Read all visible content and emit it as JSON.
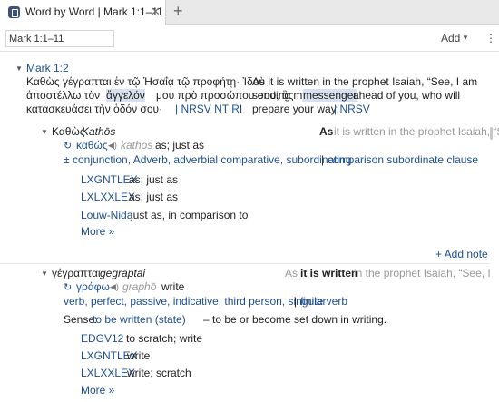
{
  "tab": {
    "title": "Word by Word | Mark 1:1–11",
    "close": "✕",
    "new": "+"
  },
  "toolbar": {
    "reference": "Mark 1:1–11",
    "add_label": "Add",
    "add_caret": "▼",
    "more": "⋮"
  },
  "passage": {
    "ref": "Mark 1:2",
    "greek_lines": [
      "Καθὼς γέγραπται ἐν τῷ Ἠσαΐᾳ τῷ προφήτῃ· Ἰδοὺ",
      "ἀποστέλλω τὸν",
      "ἄγγελόν",
      "μου πρὸ προσώπου σου, ὃς",
      "κατασκευάσει τὴν ὁδόν σου·",
      "| NRSV NT RI"
    ],
    "english_lines": [
      "As it is written in the prophet Isaiah, “See, I am",
      "sending my",
      "messenger",
      "ahead of you, who will",
      "prepare your way;",
      "| NRSV"
    ]
  },
  "word1": {
    "surface": "Καθὼς",
    "translit": "Kathōs",
    "english_bold": "As",
    "english_rest": "it is written in the prophet Isaiah, “See,",
    "lemma": "καθώς",
    "lemma_translit": "kathōs",
    "gloss": "as; just as",
    "parse_prefix": "±",
    "parse": "conjunction, Adverb, adverbial comparative, subordinating",
    "parse_sep": "|",
    "parse_extra": "comparison subordinate clause",
    "lexicons": [
      {
        "name": "LXGNTLEX",
        "def": "as; just as"
      },
      {
        "name": "LXLXXLEX",
        "def": "as; just as"
      },
      {
        "name": "Louw-Nida",
        "def": "just as, in comparison to"
      }
    ],
    "more": "More »",
    "add_note": "+ Add note"
  },
  "word2": {
    "surface": "γέγραπται",
    "translit": "gegraptai",
    "english_pre": "As",
    "english_bold": "it is written",
    "english_rest": "in the prophet Isaiah, “See, I",
    "lemma": "γράφω",
    "lemma_translit": "graphō",
    "gloss": "write",
    "parse": "verb, perfect, passive, indicative, third person, singular",
    "parse_sep": "|",
    "parse_extra": "finite verb",
    "sense_label": "Sense:",
    "sense_link": "to be written (state)",
    "sense_rest": "– to be or become set down in writing.",
    "lexicons": [
      {
        "name": "EDGV12",
        "def": "to scratch; write"
      },
      {
        "name": "LXGNTLEX",
        "def": "write"
      },
      {
        "name": "LXLXXLEX",
        "def": "write; scratch"
      }
    ],
    "more": "More »"
  }
}
